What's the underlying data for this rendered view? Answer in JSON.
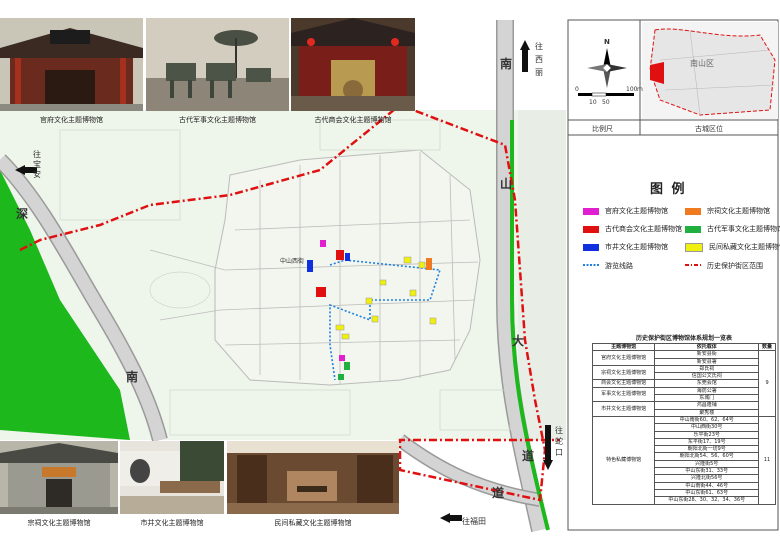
{
  "photos_top": [
    {
      "caption": "官府文化主题博物馆"
    },
    {
      "caption": "古代军事文化主题博物馆"
    },
    {
      "caption": "古代商会文化主题博物馆"
    }
  ],
  "photos_bottom": [
    {
      "caption": "宗祠文化主题博物馆"
    },
    {
      "caption": "市井文化主题博物馆"
    },
    {
      "caption": "民间私藏文化主题博物馆"
    }
  ],
  "map_labels": {
    "south_top": "南",
    "to_xili": "往西丽",
    "to_baoan": "往宝安",
    "shen": "深",
    "shan": "山",
    "da": "大",
    "nan_bottom": "南",
    "dao1": "道",
    "dao2": "道",
    "to_shekou": "往蛇口",
    "to_futian": "往福田",
    "zhongshan_west": "中山西街"
  },
  "inset": {
    "north": "N",
    "scale_ticks": [
      "0",
      "10",
      "50",
      "100"
    ],
    "scale_unit": "m",
    "district_label": "南山区",
    "label_scale": "比例尺",
    "label_location": "古城区位"
  },
  "legend": {
    "title": "图 例",
    "items": [
      {
        "label": "官府文化主题博物馆",
        "color": "#e020d0"
      },
      {
        "label": "宗祠文化主题博物馆",
        "color": "#f07a20"
      },
      {
        "label": "古代商会文化主题博物馆",
        "color": "#e01010"
      },
      {
        "label": "古代军事文化主题博物馆",
        "color": "#20b040"
      },
      {
        "label": "市井文化主题博物馆",
        "color": "#1030e0"
      },
      {
        "label": "民间私藏文化主题博物馆",
        "color": "#f0f010"
      },
      {
        "label": "游览线路",
        "color": "#2080e0"
      },
      {
        "label": "历史保护街区范围",
        "color": "#e01010"
      }
    ]
  },
  "table": {
    "title": "历史保护街区博物馆体系规划一览表",
    "headers": [
      "主题博物馆",
      "依托载体",
      "数量"
    ],
    "group1_count": "9",
    "group2_count": "11",
    "rows1": [
      {
        "theme": "官府文化主题博物馆",
        "carriers": [
          "新安县衙",
          "新安县署"
        ]
      },
      {
        "theme": "宗祠文化主题博物馆",
        "carriers": [
          "郑氏祠",
          "信国公文氏祠"
        ]
      },
      {
        "theme": "商会文化主题博物馆",
        "carriers": [
          "东莞会馆"
        ]
      },
      {
        "theme": "军事文化主题博物馆",
        "carriers": [
          "海防公署",
          "东城门"
        ]
      },
      {
        "theme": "市井文化主题博物馆",
        "carriers": [
          "鸿昌隆铺",
          "聚秀楼"
        ]
      }
    ],
    "rows2_theme": "特色私藏博物馆",
    "rows2": [
      "中山南街60、62、64号",
      "中山西街30号",
      "乐平街23号",
      "东平街17、19号",
      "朝阳北街一坊9号",
      "朝阳北街54、56、60号",
      "兴隆街5号",
      "中山东街31、33号",
      "兴隆北街56号",
      "中山南街44、46号",
      "中山东街61、63号",
      "中山东街28、30、32、34、36号"
    ]
  }
}
